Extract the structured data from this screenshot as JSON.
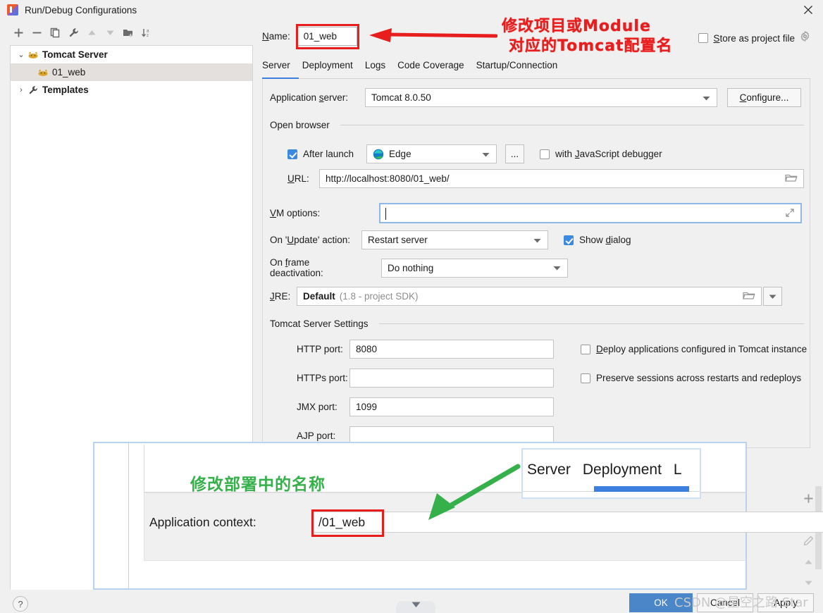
{
  "window": {
    "title": "Run/Debug Configurations",
    "app_icon": "intellij-idea-icon",
    "close_icon": "close-icon"
  },
  "left_toolbar": {
    "buttons": [
      {
        "name": "add-configuration-button",
        "icon": "plus-icon"
      },
      {
        "name": "remove-configuration-button",
        "icon": "minus-icon"
      },
      {
        "name": "copy-configuration-button",
        "icon": "copy-icon"
      },
      {
        "name": "edit-templates-button",
        "icon": "wrench-icon"
      },
      {
        "name": "move-up-button",
        "icon": "arrow-up-icon"
      },
      {
        "name": "move-down-button",
        "icon": "arrow-down-icon"
      },
      {
        "name": "new-folder-button",
        "icon": "folder-add-icon"
      },
      {
        "name": "sort-configurations-button",
        "icon": "sort-az-icon"
      }
    ]
  },
  "tree": {
    "items": [
      {
        "label": "Tomcat Server",
        "twisty": "⌄",
        "icon": "tomcat-icon",
        "bold": true,
        "selected": false,
        "indent": false
      },
      {
        "label": "01_web",
        "twisty": "",
        "icon": "tomcat-icon",
        "bold": false,
        "selected": true,
        "indent": true
      },
      {
        "label": "Templates",
        "twisty": "›",
        "icon": "wrench-icon",
        "bold": true,
        "selected": false,
        "indent": false
      }
    ]
  },
  "name_row": {
    "label": "Name:",
    "label_mnemonic": "N",
    "value": "01_web"
  },
  "store_as_project_file": {
    "label": "Store as project file",
    "label_mnemonic": "S",
    "checked": false,
    "gear_icon": "gear-icon"
  },
  "tabs": {
    "items": [
      "Server",
      "Deployment",
      "Logs",
      "Code Coverage",
      "Startup/Connection"
    ],
    "active": "Server",
    "accent_color": "#3c7fde"
  },
  "server_tab": {
    "application_server": {
      "label": "Application server:",
      "label_mnemonic": "s",
      "value": "Tomcat 8.0.50",
      "configure_button": "Configure...",
      "configure_mnemonic": "C"
    },
    "open_browser": {
      "group_title": "Open browser",
      "after_launch": {
        "label": "After launch",
        "checked": true
      },
      "browser": {
        "value": "Edge",
        "icon": "edge-browser-icon"
      },
      "browse_button": "...",
      "js_debugger": {
        "label": "with JavaScript debugger",
        "label_mnemonic": "J",
        "checked": false
      },
      "url": {
        "label": "URL:",
        "label_mnemonic": "U",
        "value": "http://localhost:8080/01_web/",
        "browse_icon": "folder-icon"
      }
    },
    "vm_options": {
      "label": "VM options:",
      "label_mnemonic": "V",
      "value": "",
      "expand_icon": "expand-icon",
      "focused": true
    },
    "on_update_action": {
      "label": "On 'Update' action:",
      "label_mnemonic": "U",
      "value": "Restart server"
    },
    "show_dialog": {
      "label": "Show dialog",
      "label_mnemonic": "d",
      "checked": true
    },
    "on_frame_deactivation": {
      "label": "On frame deactivation:",
      "label_mnemonic": "f",
      "value": "Do nothing"
    },
    "jre": {
      "label": "JRE:",
      "label_mnemonic": "J",
      "value": "Default",
      "hint": "(1.8 - project SDK)",
      "browse_icon": "folder-icon",
      "dropdown_icon": "chevron-down-icon"
    },
    "tomcat_server_settings": {
      "group_title": "Tomcat Server Settings",
      "fields": [
        {
          "label": "HTTP port:",
          "value": "8080"
        },
        {
          "label": "HTTPs port:",
          "value": ""
        },
        {
          "label": "JMX port:",
          "value": "1099"
        },
        {
          "label": "AJP port:",
          "value": ""
        }
      ],
      "checkboxes": [
        {
          "label": "Deploy applications configured in Tomcat instance",
          "label_mnemonic": "D",
          "checked": false
        },
        {
          "label": "Preserve sessions across restarts and redeploys",
          "checked": false
        }
      ]
    }
  },
  "right_rail": {
    "buttons": [
      {
        "name": "add-artifact-button",
        "icon": "plus-icon"
      },
      {
        "name": "remove-artifact-button",
        "icon": "minus-icon"
      },
      {
        "name": "edit-artifact-button",
        "icon": "pencil-icon"
      },
      {
        "name": "move-artifact-up-button",
        "icon": "arrow-up-icon"
      },
      {
        "name": "move-artifact-down-button",
        "icon": "arrow-down-icon"
      }
    ]
  },
  "bottom_bar": {
    "help": "?",
    "collapse_icon": "chevron-down-icon",
    "ok": "OK",
    "cancel": "Cancel",
    "apply": "Apply",
    "ok_color": "#4a86c8"
  },
  "annotations": {
    "red_note_line1": "修改项目或Module",
    "red_note_line2": "对应的Tomcat配置名",
    "red_color": "#e81d1d",
    "green_note": "修改部署中的名称",
    "green_color": "#35b04a",
    "red_arrow_icon": "left-arrow-icon",
    "green_arrow_icon": "down-left-arrow-icon"
  },
  "inset": {
    "application_context_label": "Application context:",
    "application_context_value": "/01_web",
    "mini_tabs": [
      "Server",
      "Deployment",
      "L"
    ],
    "accent_color": "#3c7fde"
  },
  "watermark": "CSDN @星空之路 Star"
}
